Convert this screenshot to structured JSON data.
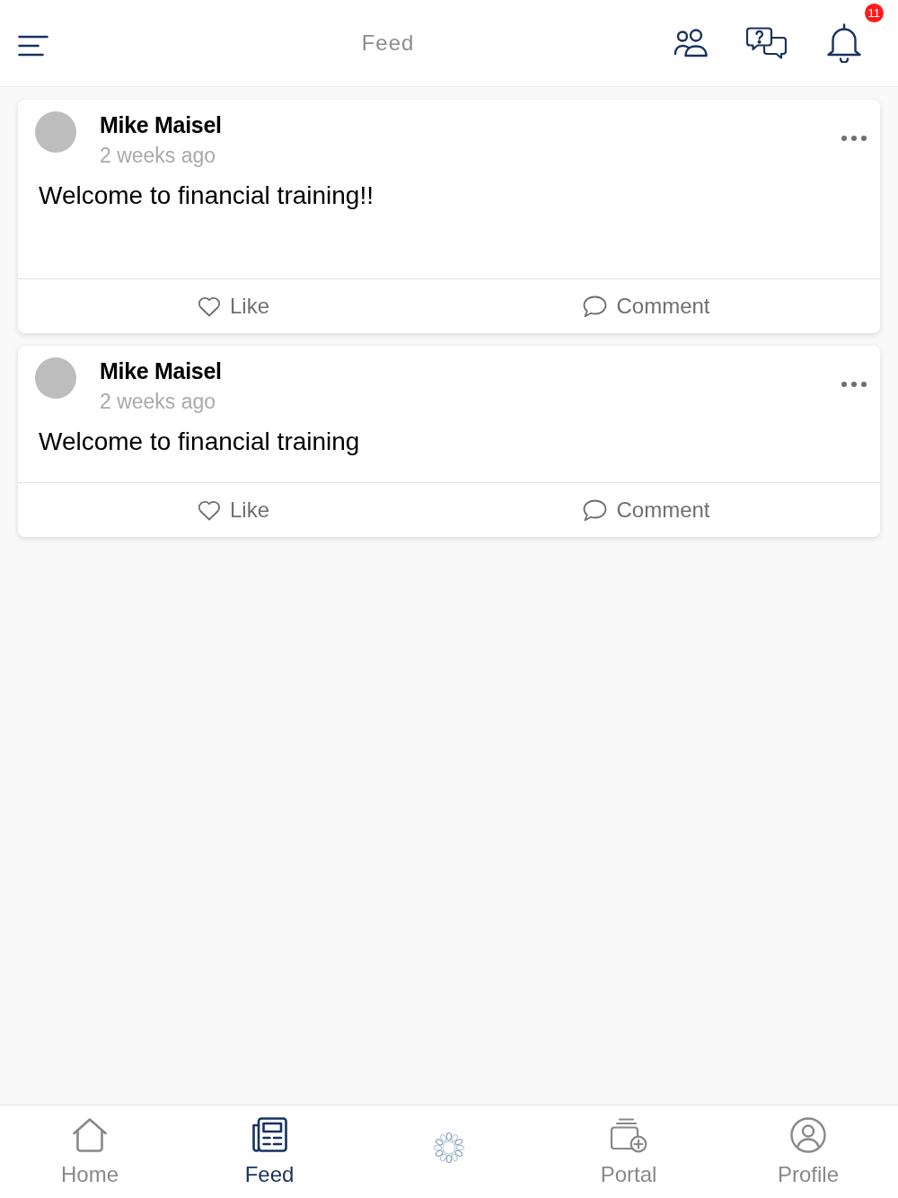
{
  "header": {
    "title": "Feed",
    "actions": [
      {
        "kind": "people"
      },
      {
        "kind": "question-chat"
      },
      {
        "kind": "bell",
        "badge": "11"
      }
    ]
  },
  "posts": [
    {
      "author": "Mike Maisel",
      "time": "2 weeks ago",
      "text": "Welcome to financial training!!",
      "actions": [
        {
          "kind": "like",
          "label": "Like"
        },
        {
          "kind": "comment",
          "label": "Comment"
        }
      ]
    },
    {
      "author": "Mike Maisel",
      "time": "2 weeks ago",
      "text": "Welcome to financial training",
      "actions": [
        {
          "kind": "like",
          "label": "Like"
        },
        {
          "kind": "comment",
          "label": "Comment"
        }
      ]
    }
  ],
  "bottom_nav": [
    {
      "kind": "home",
      "label": "Home",
      "selected": false
    },
    {
      "kind": "feed",
      "label": "Feed",
      "selected": true
    },
    {
      "kind": "spinner",
      "selected": false
    },
    {
      "kind": "portal",
      "label": "Portal",
      "selected": false
    },
    {
      "kind": "profile",
      "label": "Profile",
      "selected": false
    }
  ]
}
